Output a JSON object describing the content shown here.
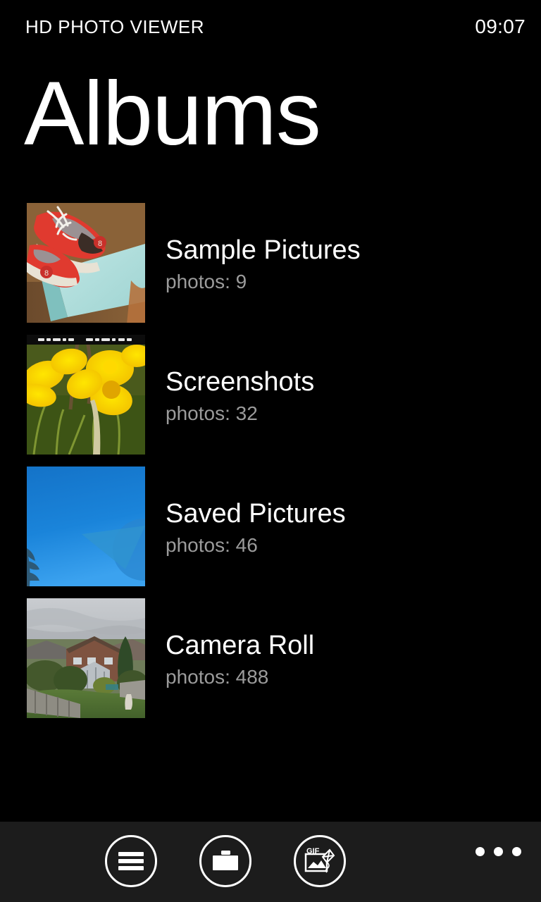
{
  "status_bar": {
    "app_name": "HD PHOTO VIEWER",
    "clock": "09:07"
  },
  "page": {
    "title": "Albums"
  },
  "albums": [
    {
      "title": "Sample Pictures",
      "count_label": "photos: 9",
      "thumbnail": "red-bowling-shoes-on-teal-table"
    },
    {
      "title": "Screenshots",
      "count_label": "photos: 32",
      "thumbnail": "yellow-daffodils-screenshot"
    },
    {
      "title": "Saved Pictures",
      "count_label": "photos: 46",
      "thumbnail": "blue-sky-with-sail-shade"
    },
    {
      "title": "Camera Roll",
      "count_label": "photos: 488",
      "thumbnail": "garden-with-brick-house"
    }
  ],
  "app_bar": {
    "buttons": [
      {
        "name": "menu-button",
        "icon": "hamburger-icon"
      },
      {
        "name": "folder-button",
        "icon": "folder-icon"
      },
      {
        "name": "gif-button",
        "icon": "gif-image-icon"
      }
    ],
    "more_label": "more-options"
  },
  "colors": {
    "background": "#000000",
    "app_bar_background": "#1c1c1c",
    "foreground": "#ffffff",
    "secondary_text": "#9b9b9b"
  }
}
